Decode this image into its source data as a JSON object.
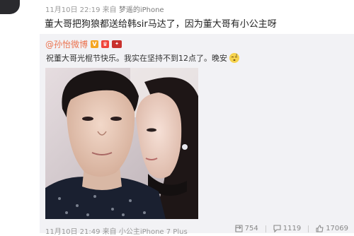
{
  "post": {
    "meta": {
      "time": "11月10日 22:19",
      "source_prefix": "来自",
      "source": "梦遥的iPhone"
    },
    "text": "董大哥把狗狼都送给韩sir马达了，因为董大哥有小公主呀"
  },
  "repost": {
    "author": "@孙怡微博",
    "text": "祝董大哥光棍节快乐。我实在坚持不到12点了。晚安",
    "meta": {
      "time": "11月10日 21:49",
      "source_prefix": "来自",
      "source": "小公主iPhone 7 Plus"
    },
    "stats": {
      "reposts": "754",
      "comments": "1119",
      "likes": "17069"
    }
  },
  "colors": {
    "author_link": "#eb7350",
    "repost_bg": "#f2f2f5"
  },
  "icons": [
    "avatar",
    "verified-v-icon",
    "vip-icon",
    "member-icon",
    "sleep-emoji-icon",
    "repost-icon",
    "comment-icon",
    "like-icon"
  ]
}
